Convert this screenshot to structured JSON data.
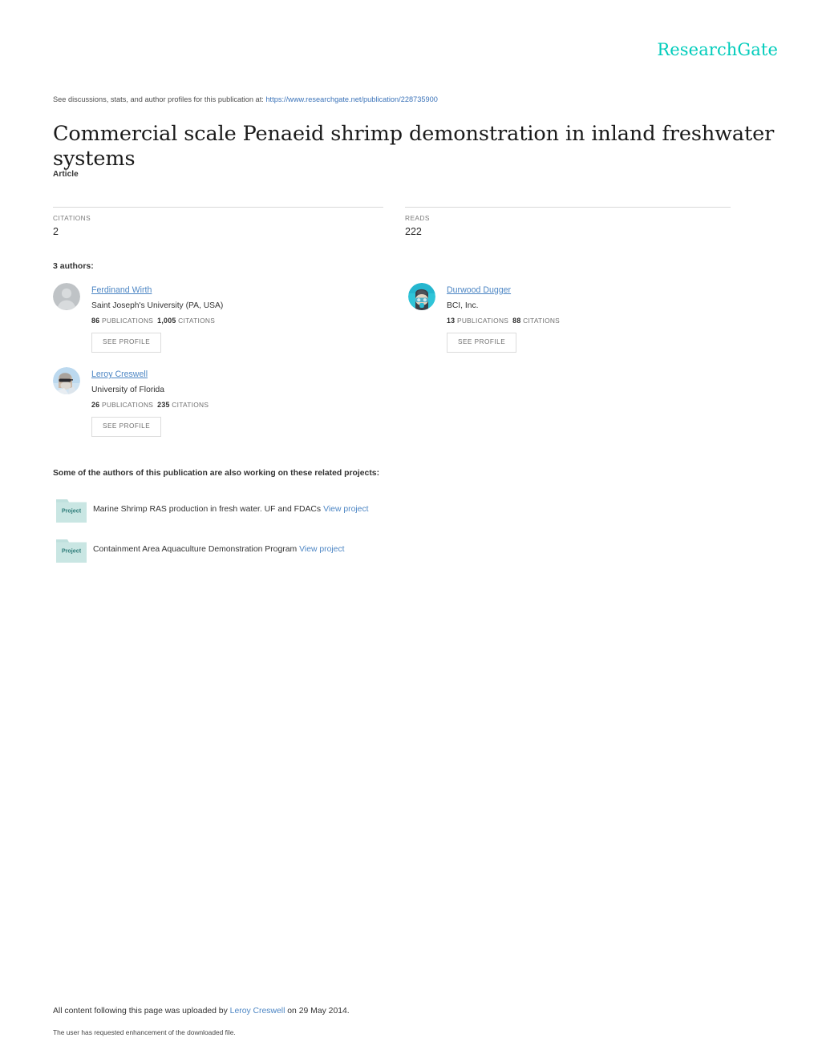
{
  "brand": {
    "logo_text": "ResearchGate",
    "logo_color": "#00ccbb"
  },
  "header": {
    "discussion_prefix": "See discussions, stats, and author profiles for this publication at:",
    "publication_url": "https://www.researchgate.net/publication/228735900"
  },
  "publication": {
    "title": "Commercial scale Penaeid shrimp demonstration in inland freshwater systems",
    "type": "Article"
  },
  "metrics": [
    {
      "label": "CITATIONS",
      "value": "2"
    },
    {
      "label": "READS",
      "value": "222"
    }
  ],
  "authors_section": {
    "count_label": "3 authors:",
    "see_profile_label": "SEE PROFILE",
    "publications_label": "PUBLICATIONS",
    "citations_label": "CITATIONS",
    "authors": [
      {
        "name": "Ferdinand Wirth",
        "affiliation": "Saint Joseph's University (PA, USA)",
        "publications": "86",
        "citations": "1,005",
        "avatar": "default-silhouette-avatar"
      },
      {
        "name": "Durwood Dugger",
        "affiliation": "BCI, Inc.",
        "publications": "13",
        "citations": "88",
        "avatar": "photo-avatar-diving-mask"
      },
      {
        "name": "Leroy Creswell",
        "affiliation": "University of Florida",
        "publications": "26",
        "citations": "235",
        "avatar": "photo-avatar-bearded-man-sunglasses"
      }
    ]
  },
  "projects_section": {
    "heading": "Some of the authors of this publication are also working on these related projects:",
    "folder_label": "Project",
    "view_project_label": "View project",
    "projects": [
      {
        "title": "Marine Shrimp RAS production in fresh water. UF and FDACs"
      },
      {
        "title": "Containment Area Aquaculture Demonstration Program"
      }
    ]
  },
  "footer": {
    "upload_prefix": "All content following this page was uploaded by",
    "uploader": "Leroy Creswell",
    "upload_suffix": "on 29 May 2014.",
    "note": "The user has requested enhancement of the downloaded file."
  }
}
